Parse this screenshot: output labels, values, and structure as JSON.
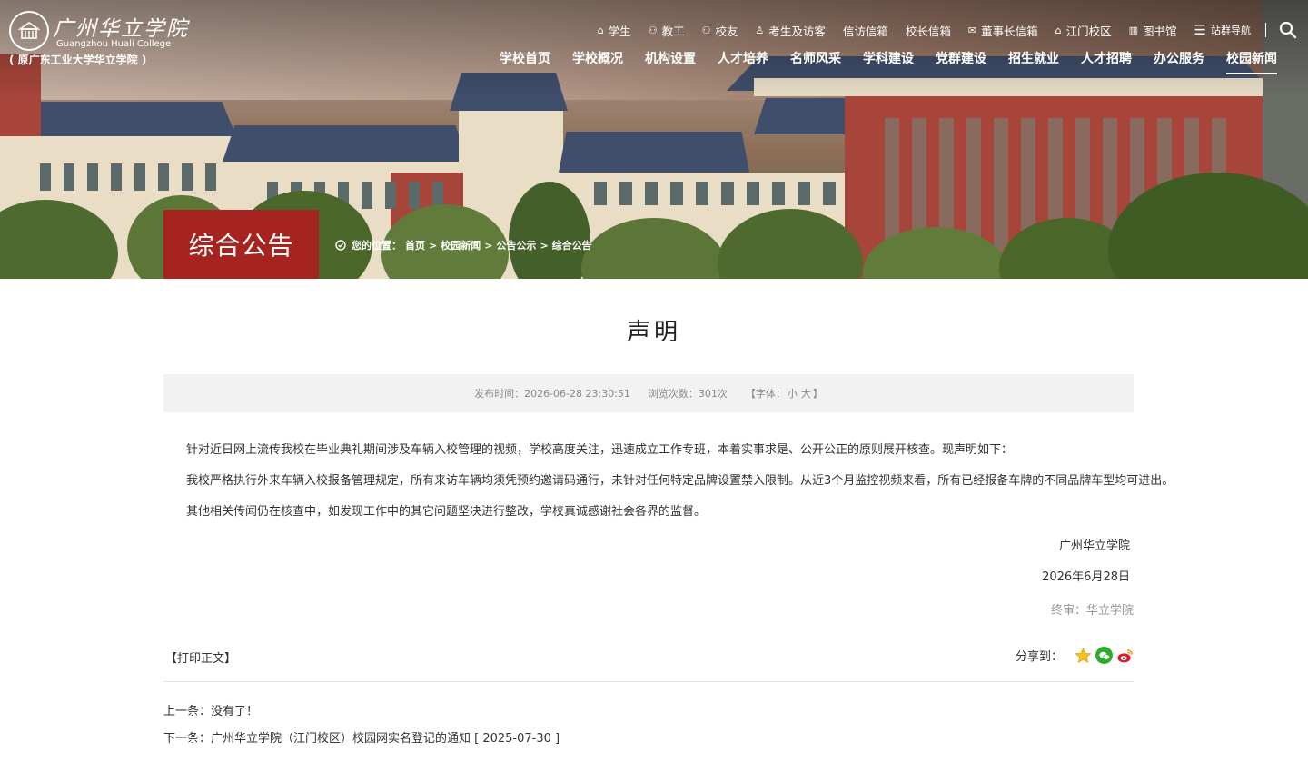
{
  "header": {
    "logo_cn": "广州华立学院",
    "logo_en": "Guangzhou Huali College",
    "logo_old": "( 原广东工业大学华立学院 )",
    "util_links": [
      {
        "icon": "graduation-cap-icon",
        "label": "学生"
      },
      {
        "icon": "teacher-icon",
        "label": "教工"
      },
      {
        "icon": "alumni-icon",
        "label": "校友"
      },
      {
        "icon": "visitor-icon",
        "label": "考生及访客"
      },
      {
        "icon": "",
        "label": "信访信箱"
      },
      {
        "icon": "",
        "label": "校长信箱"
      },
      {
        "icon": "mail-icon",
        "label": "董事长信箱"
      },
      {
        "icon": "campus-icon",
        "label": "江门校区"
      },
      {
        "icon": "library-icon",
        "label": "图书馆"
      },
      {
        "icon": "menu-icon",
        "label": "站群导航"
      }
    ],
    "main_nav": [
      "学校首页",
      "学校概况",
      "机构设置",
      "人才培养",
      "名师风采",
      "学科建设",
      "党群建设",
      "招生就业",
      "人才招聘",
      "办公服务",
      "校园新闻"
    ],
    "active_nav": "校园新闻"
  },
  "section": {
    "title": "综合公告"
  },
  "breadcrumb": {
    "prefix": "您的位置：",
    "items": [
      "首页",
      "校园新闻",
      "公告公示",
      "综合公告"
    ],
    "separator": ">"
  },
  "article": {
    "title": "声明",
    "meta": {
      "publish": "发布时间：2026-06-28 23:30:51",
      "views": "浏览次数：301次",
      "font_open": "【字体：",
      "font_small": "小",
      "font_large": "大",
      "font_close": "】"
    },
    "paragraphs": [
      "针对近日网上流传我校在毕业典礼期间涉及车辆入校管理的视频，学校高度关注，迅速成立工作专班，本着实事求是、公开公正的原则展开核查。现声明如下：",
      "我校严格执行外来车辆入校报备管理规定，所有来访车辆均须凭预约邀请码通行，未针对任何特定品牌设置禁入限制。从近3个月监控视频来看，所有已经报备车牌的不同品牌车型均可进出。",
      "其他相关传闻仍在核查中，如发现工作中的其它问题坚决进行整改，学校真诚感谢社会各界的监督。"
    ],
    "signature": "广州华立学院",
    "date": "2026年6月28日",
    "reviewer": "终审：华立学院"
  },
  "footer_actions": {
    "print": "【打印正文】",
    "share_label": "分享到：",
    "share_icons": [
      "qzone-icon",
      "wechat-icon",
      "weibo-icon"
    ],
    "prev_label": "上一条：",
    "prev_value": "没有了！",
    "next_label": "下一条：",
    "next_value": "广州华立学院（江门校区）校园网实名登记的通知 [ 2025-07-30 ]"
  },
  "colors": {
    "brand_red": "#a52420",
    "meta_bg": "#f2f2f2"
  }
}
